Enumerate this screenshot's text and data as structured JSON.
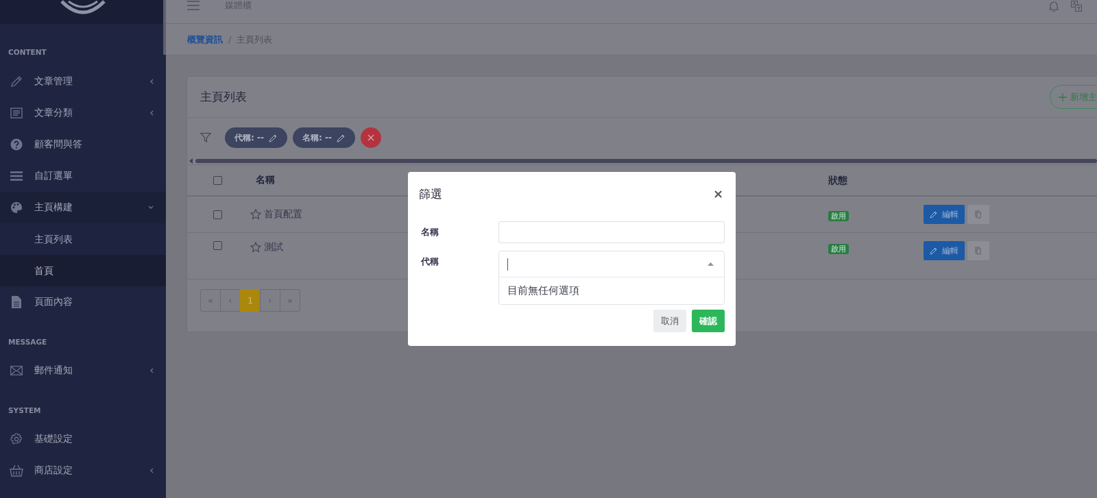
{
  "sidebar": {
    "sections": [
      {
        "title": "CONTENT",
        "items": [
          {
            "label": "文章管理",
            "expandable": true,
            "expanded": false
          },
          {
            "label": "文章分類",
            "expandable": true,
            "expanded": false
          },
          {
            "label": "顧客問與答",
            "expandable": false
          },
          {
            "label": "自訂選單",
            "expandable": false
          },
          {
            "label": "主頁構建",
            "expandable": true,
            "expanded": true,
            "children": [
              {
                "label": "主頁列表",
                "selected": false
              },
              {
                "label": "首頁",
                "selected": true
              }
            ]
          },
          {
            "label": "頁面內容",
            "expandable": false
          }
        ]
      },
      {
        "title": "MESSAGE",
        "items": [
          {
            "label": "郵件通知",
            "expandable": true,
            "expanded": false
          }
        ]
      },
      {
        "title": "SYSTEM",
        "items": [
          {
            "label": "基礎設定",
            "expandable": false
          },
          {
            "label": "商店設定",
            "expandable": true,
            "expanded": false
          }
        ]
      }
    ]
  },
  "header": {
    "title": "媒體櫃"
  },
  "breadcrumb": {
    "items": [
      {
        "label": "概覽資訊",
        "link": true
      },
      {
        "label": "主頁列表",
        "link": false
      }
    ],
    "separator": "/"
  },
  "card": {
    "title": "主頁列表",
    "add_button": "新增主",
    "filter_chips": [
      {
        "label": "代稱: --"
      },
      {
        "label": "名稱: --"
      }
    ],
    "table": {
      "header_checked": false,
      "columns": [
        "名稱",
        "狀態"
      ],
      "rows": [
        {
          "checked": false,
          "starred": false,
          "name": "首頁配置",
          "status": "啟用",
          "edit": "編輯"
        },
        {
          "checked": false,
          "starred": false,
          "name": "測試",
          "status": "啟用",
          "edit": "編輯"
        }
      ]
    },
    "pagination": [
      {
        "label": "«",
        "selected": false
      },
      {
        "label": "‹",
        "selected": false
      },
      {
        "label": "1",
        "selected": true
      },
      {
        "label": "›",
        "selected": false
      },
      {
        "label": "»",
        "selected": false
      }
    ]
  },
  "modal": {
    "title": "篩選",
    "close": "×",
    "fields": [
      {
        "kind": "text",
        "label": "名稱"
      },
      {
        "kind": "select",
        "label": "代稱",
        "expanded": true,
        "empty_message": "目前無任何選項"
      }
    ],
    "buttons": [
      {
        "kind": "secondary",
        "label": "取消"
      },
      {
        "kind": "primary",
        "label": "確認"
      }
    ]
  }
}
